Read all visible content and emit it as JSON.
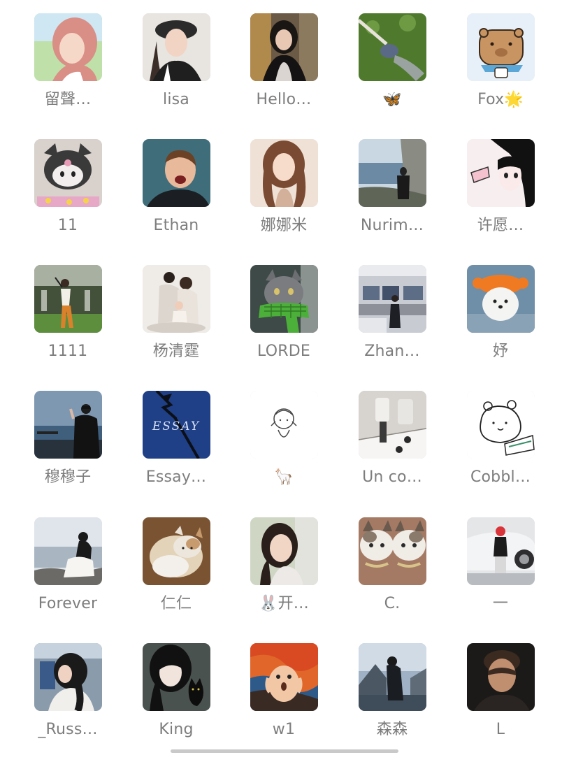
{
  "members": [
    {
      "name": "留聲…",
      "avatar": "anime-girl-pink-hair-avatar"
    },
    {
      "name": "lisa",
      "avatar": "girl-bucket-hat-avatar"
    },
    {
      "name": "Hello…",
      "avatar": "girl-long-hair-store-avatar"
    },
    {
      "name": "🦋",
      "avatar": "person-lying-on-grass-avatar"
    },
    {
      "name": "Fox🌟",
      "avatar": "capybara-cartoon-avatar"
    },
    {
      "name": "11",
      "avatar": "kuromi-plush-avatar"
    },
    {
      "name": "Ethan",
      "avatar": "laughing-boy-avatar"
    },
    {
      "name": "娜娜米",
      "avatar": "doll-girl-avatar"
    },
    {
      "name": "Nurim…",
      "avatar": "man-by-the-sea-avatar"
    },
    {
      "name": "许愿…",
      "avatar": "manga-girl-avatar"
    },
    {
      "name": "1111",
      "avatar": "golf-swing-avatar"
    },
    {
      "name": "杨清霆",
      "avatar": "family-photo-avatar"
    },
    {
      "name": "LORDE",
      "avatar": "cat-green-scarf-avatar"
    },
    {
      "name": "Zhan…",
      "avatar": "office-room-avatar"
    },
    {
      "name": "妤",
      "avatar": "dog-orange-hat-avatar"
    },
    {
      "name": "穆穆子",
      "avatar": "woman-on-balcony-avatar"
    },
    {
      "name": "Essay…",
      "avatar": "essay-blue-sky-avatar"
    },
    {
      "name": "🦙",
      "avatar": "line-doodle-girl-avatar"
    },
    {
      "name": "Un co…",
      "avatar": "chess-pieces-avatar"
    },
    {
      "name": "Cobbl…",
      "avatar": "hamster-doodle-avatar"
    },
    {
      "name": "Forever",
      "avatar": "girl-sitting-seaside-avatar"
    },
    {
      "name": "仁仁",
      "avatar": "cat-on-bed-avatar"
    },
    {
      "name": "🐰开…",
      "avatar": "woman-portrait-avatar"
    },
    {
      "name": "C.",
      "avatar": "two-cats-avatar"
    },
    {
      "name": "一",
      "avatar": "child-by-car-avatar"
    },
    {
      "name": "_Russ…",
      "avatar": "woman-on-train-avatar"
    },
    {
      "name": "King",
      "avatar": "anime-girl-black-cat-avatar"
    },
    {
      "name": "w1",
      "avatar": "hamster-scream-avatar"
    },
    {
      "name": "森森",
      "avatar": "man-at-coast-avatar"
    },
    {
      "name": "L",
      "avatar": "man-dark-portrait-avatar"
    }
  ]
}
